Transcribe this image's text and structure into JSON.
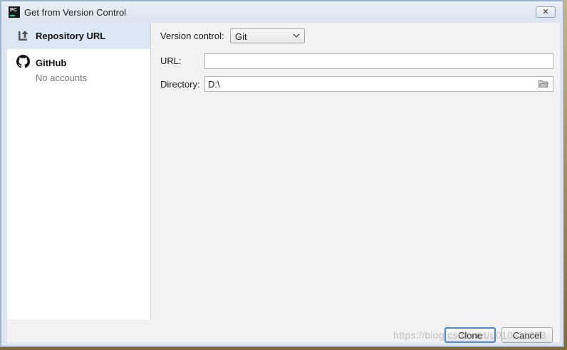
{
  "window": {
    "title": "Get from Version Control",
    "app_icon_text": "PC",
    "close_symbol": "✕"
  },
  "sidebar": {
    "items": [
      {
        "label": "Repository URL",
        "icon": "repository-url-icon",
        "selected": true
      },
      {
        "label": "GitHub",
        "sublabel": "No accounts",
        "icon": "github-icon",
        "selected": false
      }
    ]
  },
  "form": {
    "version_control_label": "Version control:",
    "version_control_value": "Git",
    "url_label": "URL:",
    "url_value": "",
    "directory_label": "Directory:",
    "directory_value": "D:\\"
  },
  "buttons": {
    "clone": "Clone",
    "cancel": "Cancel"
  },
  "watermark": "https://blog.csdn.net/u010111893",
  "colors": {
    "selection": "#dbe7f5",
    "accent": "#4a86c8",
    "background": "#f2f2f2"
  }
}
